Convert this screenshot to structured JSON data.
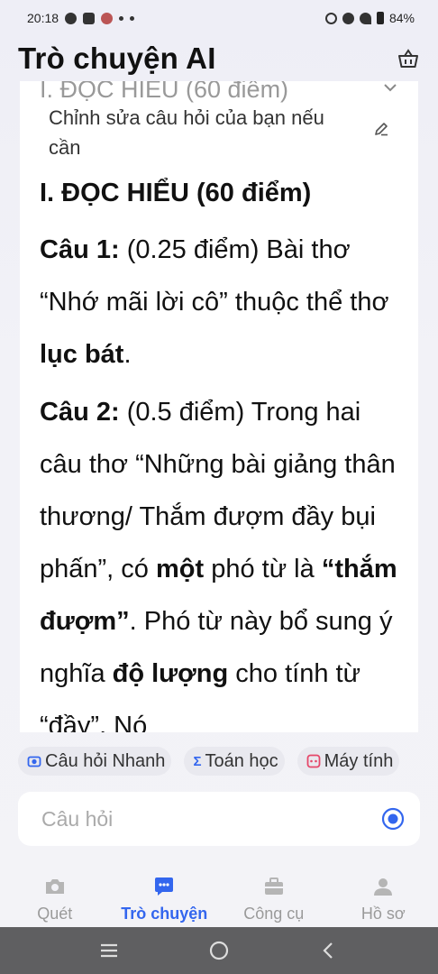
{
  "status_bar": {
    "time": "20:18",
    "battery": "84%"
  },
  "header": {
    "title": "Trò chuyện AI"
  },
  "conversation": {
    "ghost_title": "I. ĐỌC HIỂU (60 điểm)",
    "question": "Chỉnh sửa câu hỏi của bạn nếu cần",
    "answer": {
      "heading": "I. ĐỌC HIỂU (60 điểm)",
      "q1_label": "Câu 1:",
      "q1_text": " (0.25 điểm) Bài thơ “Nhớ mãi lời cô” thuộc thể thơ ",
      "q1_bold": "lục bát",
      "q1_end": ".",
      "q2_label": "Câu 2:",
      "q2_text1": " (0.5 điểm) Trong hai câu thơ “Những bài giảng thân thương/ Thắm đượm đầy bụi phấn”, có ",
      "q2_bold1": "một",
      "q2_text2": " phó từ là ",
      "q2_bold2": "“thắm đượm”",
      "q2_text3": ". Phó từ này bổ sung ý nghĩa ",
      "q2_bold3": "độ lượng",
      "q2_text4": " cho tính từ “đầy”. Nó"
    }
  },
  "chips": [
    {
      "label": "Câu hỏi Nhanh",
      "icon": "camera-icon"
    },
    {
      "label": "Toán học",
      "icon": "sigma-icon",
      "glyph": "Σ"
    },
    {
      "label": "Máy tính",
      "icon": "calculator-icon"
    }
  ],
  "input": {
    "placeholder": "Câu hỏi"
  },
  "bottom_nav": [
    {
      "label": "Quét",
      "icon": "camera-icon"
    },
    {
      "label": "Trò chuyện",
      "icon": "chat-icon"
    },
    {
      "label": "Công cụ",
      "icon": "toolbox-icon"
    },
    {
      "label": "Hồ sơ",
      "icon": "user-icon"
    }
  ],
  "colors": {
    "accent": "#3366ee",
    "chip_camera": "#3366ee",
    "chip_sigma": "#3366ee",
    "chip_calculator": "#e5486a",
    "inactive": "#9a9a9a"
  }
}
